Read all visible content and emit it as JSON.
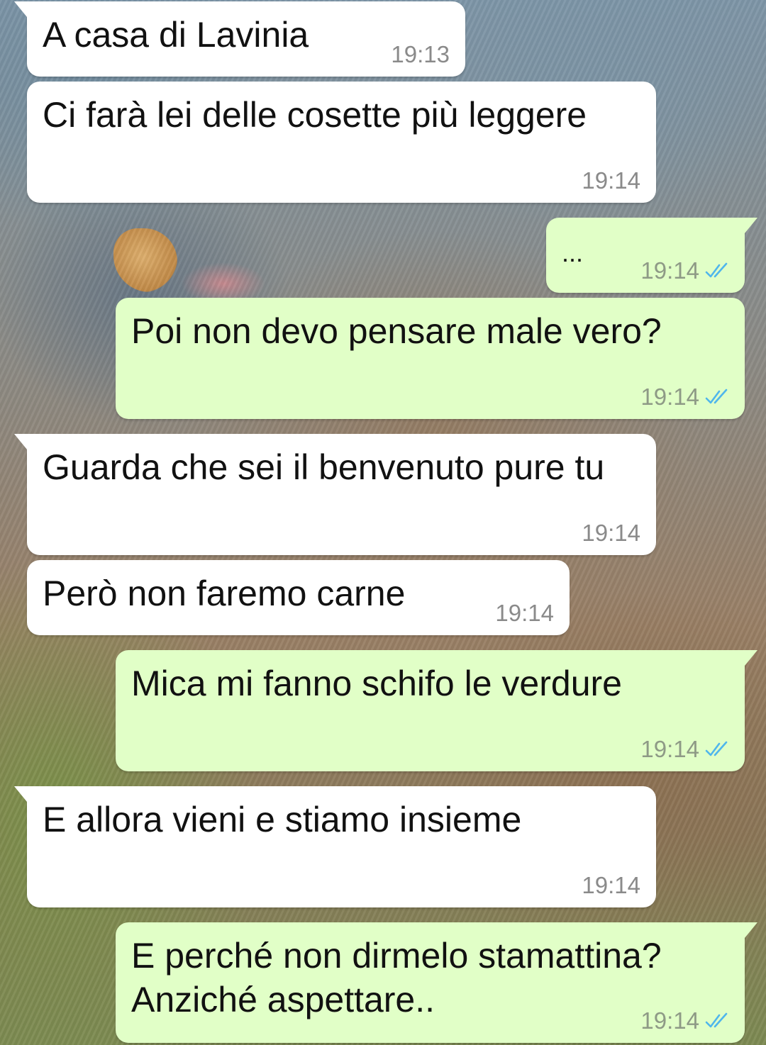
{
  "chat": {
    "colors": {
      "incoming_bubble": "#ffffff",
      "outgoing_bubble": "#e1ffc7",
      "read_ticks": "#4fb6ec"
    },
    "messages": [
      {
        "direction": "incoming",
        "text": "A casa di Lavinia",
        "time": "19:13"
      },
      {
        "direction": "incoming",
        "text": "Ci farà lei delle cosette più leggere",
        "time": "19:14"
      },
      {
        "direction": "outgoing",
        "text": "...",
        "time": "19:14",
        "status": "read"
      },
      {
        "direction": "outgoing",
        "text": "Poi non devo pensare male vero?",
        "time": "19:14",
        "status": "read"
      },
      {
        "direction": "incoming",
        "text": "Guarda che sei il benvenuto pure tu",
        "time": "19:14"
      },
      {
        "direction": "incoming",
        "text": "Però non faremo carne",
        "time": "19:14"
      },
      {
        "direction": "outgoing",
        "text": "Mica mi fanno schifo le verdure",
        "time": "19:14",
        "status": "read"
      },
      {
        "direction": "incoming",
        "text": "E allora vieni e stiamo insieme",
        "time": "19:14"
      },
      {
        "direction": "outgoing",
        "text": "E perché non dirmelo stamattina? Anziché aspettare..",
        "time": "19:14",
        "status": "read"
      }
    ]
  }
}
